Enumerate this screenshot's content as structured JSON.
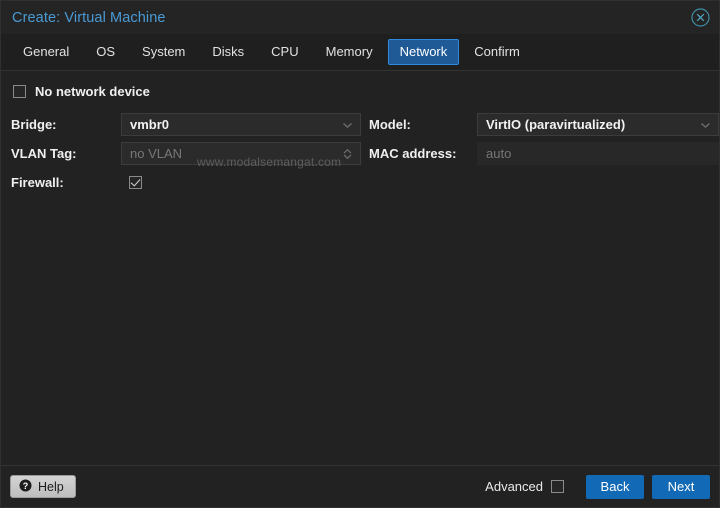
{
  "window": {
    "title": "Create: Virtual Machine",
    "close_icon": "close-circle-icon"
  },
  "tabs": [
    {
      "label": "General",
      "active": false
    },
    {
      "label": "OS",
      "active": false
    },
    {
      "label": "System",
      "active": false
    },
    {
      "label": "Disks",
      "active": false
    },
    {
      "label": "CPU",
      "active": false
    },
    {
      "label": "Memory",
      "active": false
    },
    {
      "label": "Network",
      "active": true
    },
    {
      "label": "Confirm",
      "active": false
    }
  ],
  "form": {
    "no_network_device": {
      "label": "No network device",
      "checked": false
    },
    "left": [
      {
        "label": "Bridge:",
        "value": "vmbr0",
        "placeholder": "",
        "type": "combobox",
        "icon": "chevron-down-icon"
      },
      {
        "label": "VLAN Tag:",
        "value": "",
        "placeholder": "no VLAN",
        "type": "spinner",
        "icon": "spinner-updown-icon"
      },
      {
        "label": "Firewall:",
        "value": "",
        "placeholder": "",
        "type": "checkbox",
        "checked": true
      }
    ],
    "right": [
      {
        "label": "Model:",
        "value": "VirtIO (paravirtualized)",
        "placeholder": "",
        "type": "combobox",
        "icon": "chevron-down-icon"
      },
      {
        "label": "MAC address:",
        "value": "",
        "placeholder": "auto",
        "type": "textfield",
        "icon": ""
      }
    ]
  },
  "watermark": "www.modalsemangat.com",
  "footer": {
    "help_label": "Help",
    "help_icon": "question-mark-icon",
    "advanced_label": "Advanced",
    "advanced_checked": false,
    "back_label": "Back",
    "next_label": "Next"
  },
  "colors": {
    "title_blue": "#4a9ad4",
    "tab_active_bg": "#1f5a96",
    "tab_active_border": "#2e8ae0",
    "primary_button": "#1269b5",
    "window_bg": "#222222"
  }
}
